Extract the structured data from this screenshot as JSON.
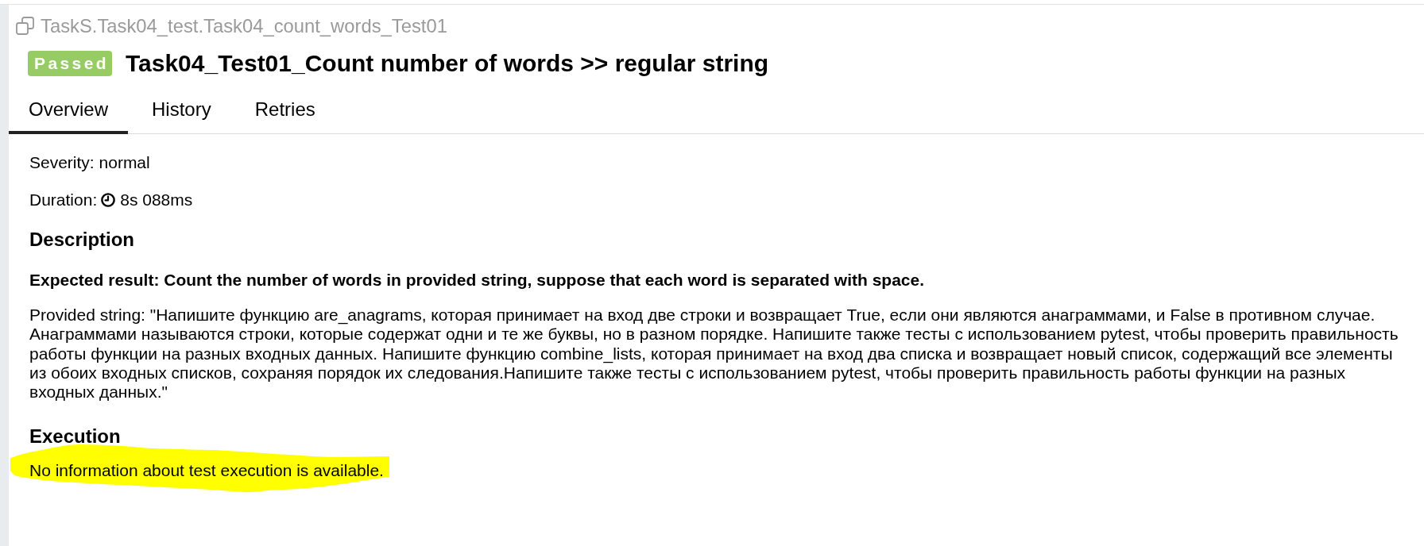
{
  "breadcrumb": {
    "path": "TaskS.Task04_test.Task04_count_words_Test01"
  },
  "header": {
    "status": {
      "label": "Passed",
      "kind": "passed"
    },
    "title": "Task04_Test01_Count number of words >> regular string"
  },
  "tabs": [
    {
      "label": "Overview",
      "selected": true
    },
    {
      "label": "History",
      "selected": false
    },
    {
      "label": "Retries",
      "selected": false
    }
  ],
  "overview": {
    "severity": "Severity: normal",
    "duration": {
      "label": "Duration:",
      "value": "8s 088ms"
    },
    "description": {
      "heading": "Description",
      "expected": "Expected result: Count the number of words in provided string, suppose that each word is separated with space.",
      "text": "Provided string: \"Напишите функцию are_anagrams, которая принимает на вход две строки и возвращает True, если они являются анаграммами, и False в противном случае. Анаграммами называются строки, которые содержат одни и те же буквы, но в разном порядке. Напишите также тесты с использованием pytest, чтобы проверить правильность работы функции на разных входных данных. Напишите функцию combine_lists, которая принимает на вход два списка и возвращает новый список, содержащий все элементы из обоих входных списков, сохраняя порядок их следования.Напишите также тесты с использованием pytest, чтобы проверить правильность работы функции на разных входных данных.\""
    },
    "execution": {
      "heading": "Execution",
      "message": "No information about test execution is available.",
      "highlighted": true
    }
  }
}
